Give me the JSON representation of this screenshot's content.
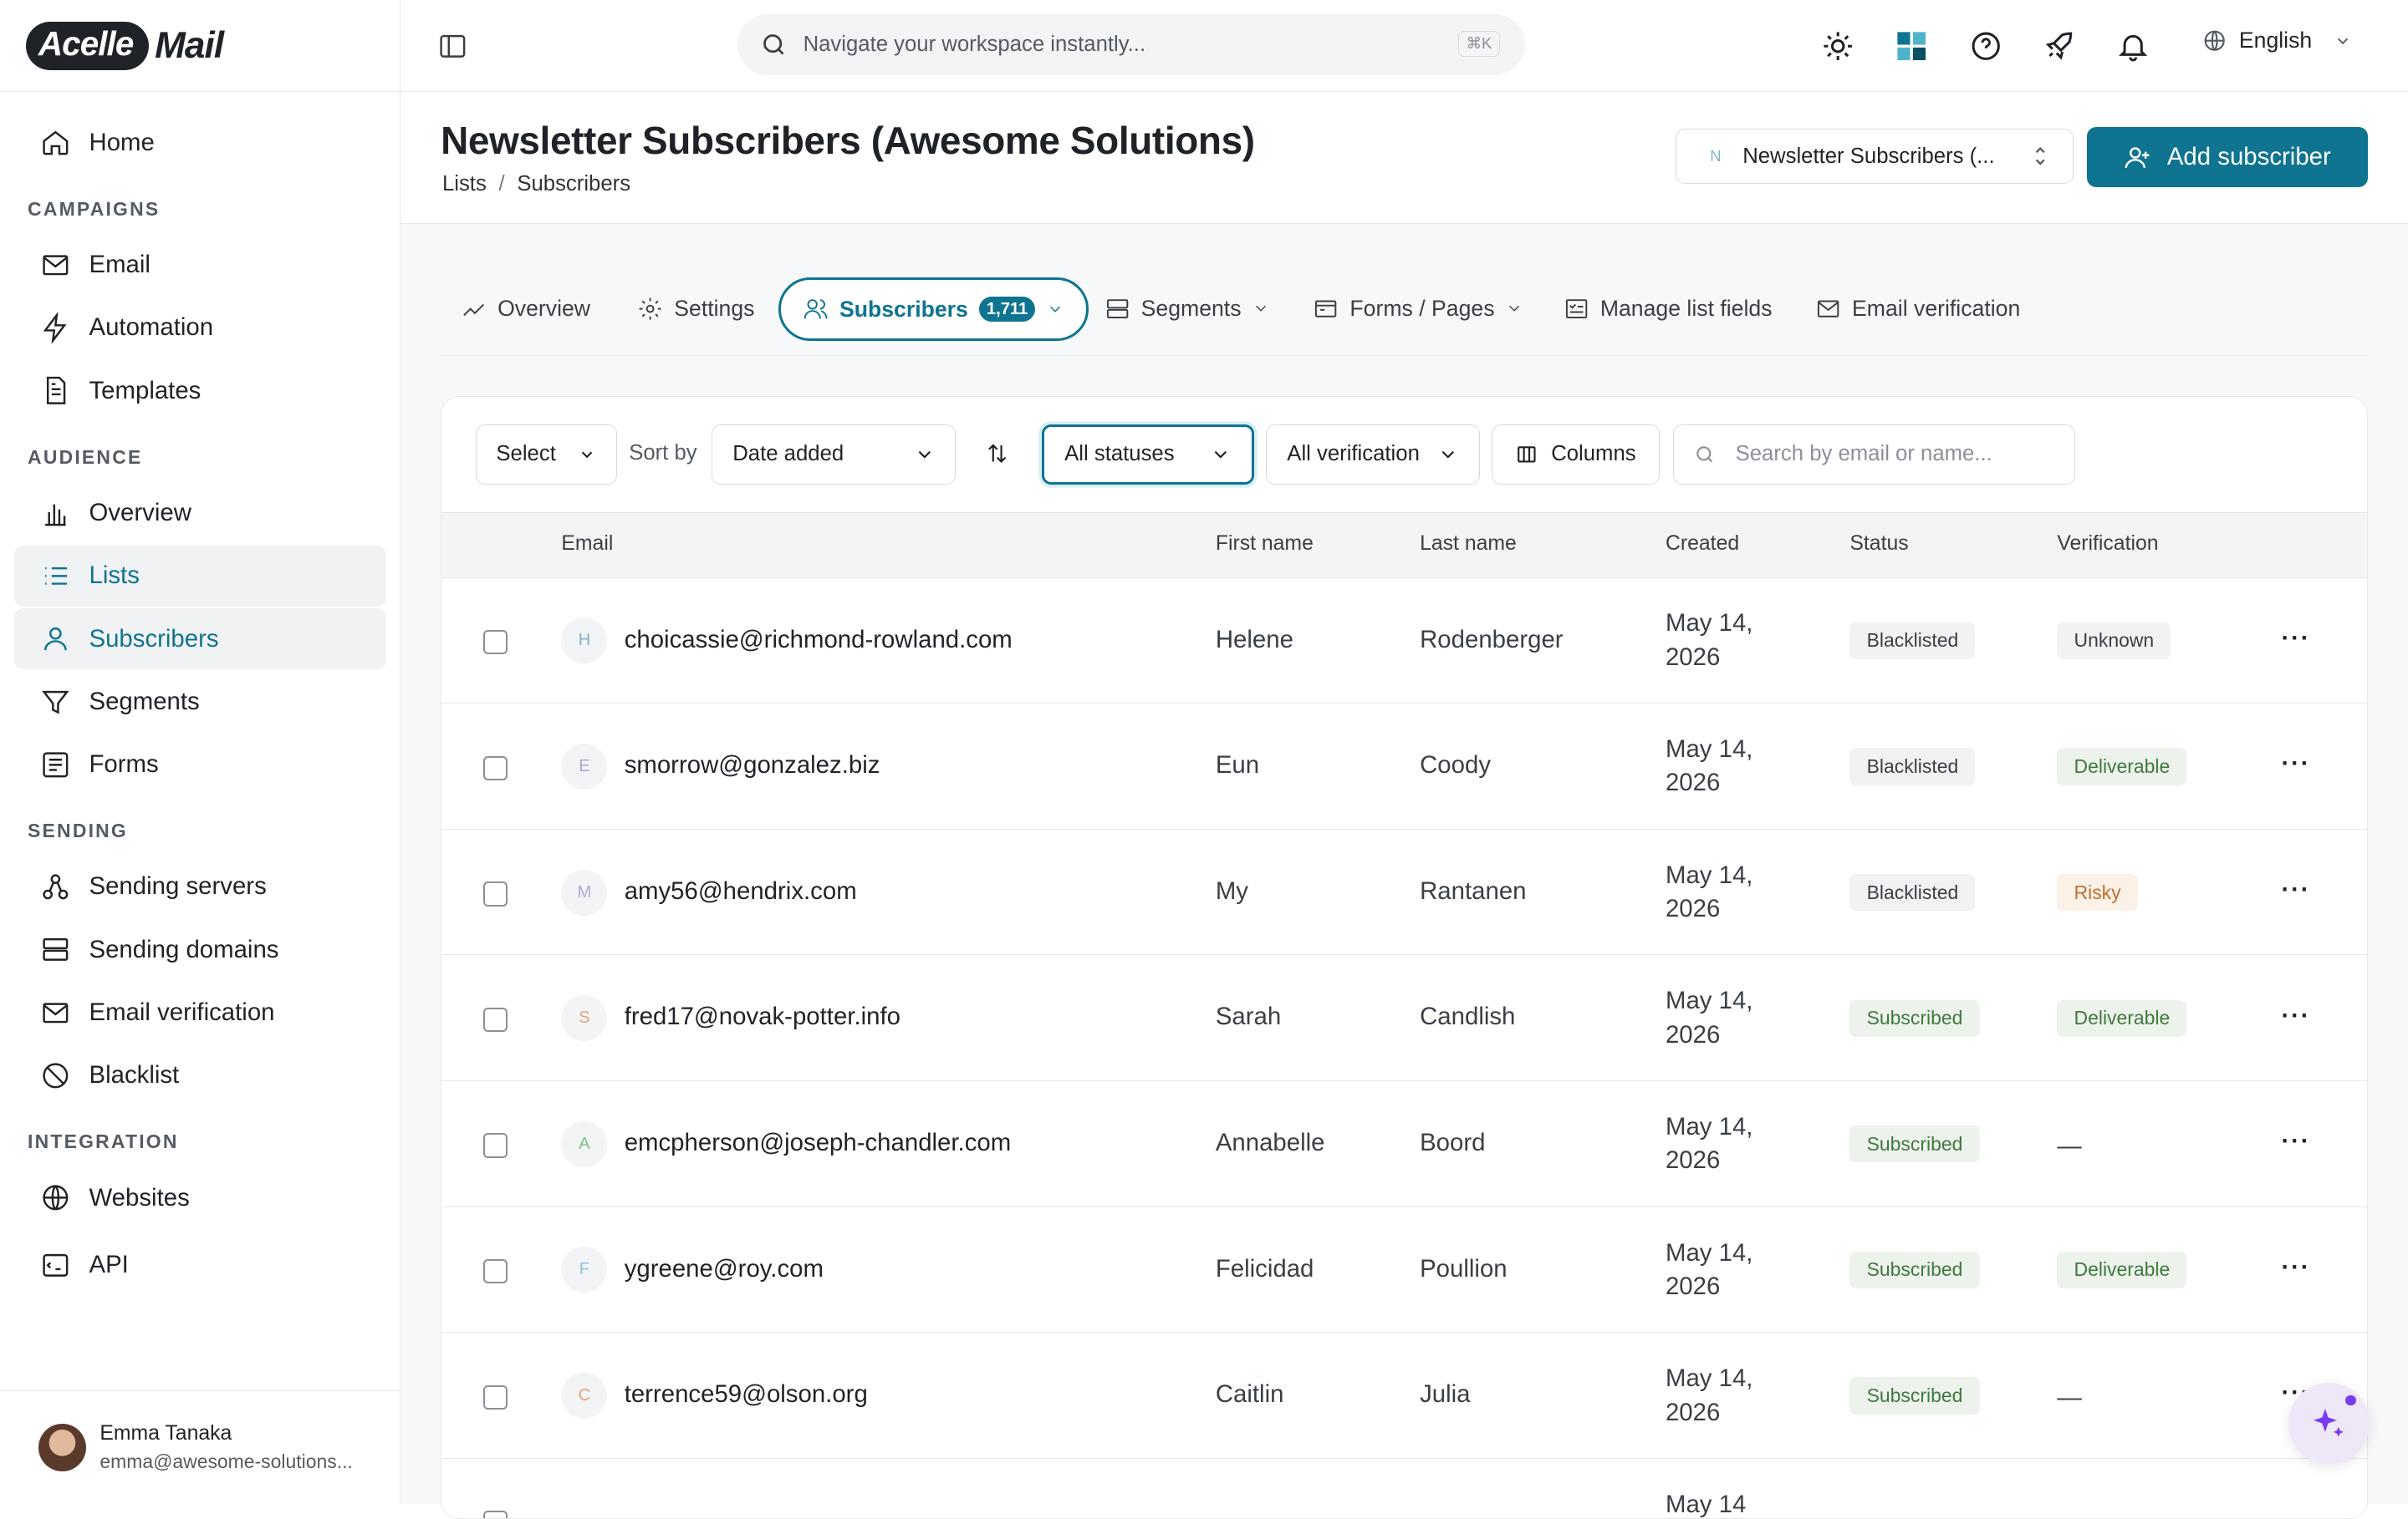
{
  "app": {
    "logo_primary": "Acelle",
    "logo_secondary": "Mail"
  },
  "sidebar": {
    "home": "Home",
    "sections": {
      "campaigns": "CAMPAIGNS",
      "audience": "AUDIENCE",
      "sending": "SENDING",
      "integration": "INTEGRATION"
    },
    "items": {
      "email": "Email",
      "automation": "Automation",
      "templates": "Templates",
      "overview": "Overview",
      "lists": "Lists",
      "subscribers": "Subscribers",
      "segments": "Segments",
      "forms": "Forms",
      "sending_servers": "Sending servers",
      "sending_domains": "Sending domains",
      "email_verification": "Email verification",
      "blacklist": "Blacklist",
      "websites": "Websites",
      "api": "API"
    },
    "user": {
      "name": "Emma Tanaka",
      "email": "emma@awesome-solutions..."
    }
  },
  "topbar": {
    "search_placeholder": "Navigate your workspace instantly...",
    "shortcut": "⌘K",
    "language": "English"
  },
  "header": {
    "title": "Newsletter Subscribers (Awesome Solutions)",
    "breadcrumb": [
      "Lists",
      "Subscribers"
    ],
    "list_selector": {
      "initial": "N",
      "label": "Newsletter Subscribers (..."
    },
    "add_button": "Add subscriber"
  },
  "tabs": {
    "overview": "Overview",
    "settings": "Settings",
    "subscribers": "Subscribers",
    "subscribers_count": "1,711",
    "segments": "Segments",
    "forms": "Forms / Pages",
    "fields": "Manage list fields",
    "verification": "Email verification"
  },
  "toolbar": {
    "select": "Select",
    "sort_by": "Sort by",
    "sort_value": "Date added",
    "status_filter": "All statuses",
    "verification_filter": "All verification",
    "columns": "Columns",
    "search_placeholder": "Search by email or name..."
  },
  "table": {
    "headers": {
      "email": "Email",
      "first": "First name",
      "last": "Last name",
      "created": "Created",
      "status": "Status",
      "verification": "Verification"
    },
    "rows": [
      {
        "initial": "H",
        "initial_color": "#7fb4c7",
        "email": "choicassie@richmond-rowland.com",
        "first": "Helene",
        "last": "Rodenberger",
        "created": "May 14, 2026",
        "status": "Blacklisted",
        "verification": "Unknown"
      },
      {
        "initial": "E",
        "initial_color": "#a9a3d6",
        "email": "smorrow@gonzalez.biz",
        "first": "Eun",
        "last": "Coody",
        "created": "May 14, 2026",
        "status": "Blacklisted",
        "verification": "Deliverable"
      },
      {
        "initial": "M",
        "initial_color": "#b7a6d9",
        "email": "amy56@hendrix.com",
        "first": "My",
        "last": "Rantanen",
        "created": "May 14, 2026",
        "status": "Blacklisted",
        "verification": "Risky"
      },
      {
        "initial": "S",
        "initial_color": "#e5a17a",
        "email": "fred17@novak-potter.info",
        "first": "Sarah",
        "last": "Candlish",
        "created": "May 14, 2026",
        "status": "Subscribed",
        "verification": "Deliverable"
      },
      {
        "initial": "A",
        "initial_color": "#7fbf8a",
        "email": "emcpherson@joseph-chandler.com",
        "first": "Annabelle",
        "last": "Boord",
        "created": "May 14, 2026",
        "status": "Subscribed",
        "verification": "—"
      },
      {
        "initial": "F",
        "initial_color": "#8fc6d9",
        "email": "ygreene@roy.com",
        "first": "Felicidad",
        "last": "Poullion",
        "created": "May 14, 2026",
        "status": "Subscribed",
        "verification": "Deliverable"
      },
      {
        "initial": "C",
        "initial_color": "#e5a17a",
        "email": "terrence59@olson.org",
        "first": "Caitlin",
        "last": "Julia",
        "created": "May 14, 2026",
        "status": "Subscribed",
        "verification": "—"
      },
      {
        "initial": "",
        "initial_color": "#7fb4c7",
        "email": "",
        "first": "",
        "last": "",
        "created": "May 14",
        "status": "",
        "verification": ""
      }
    ]
  },
  "colors": {
    "accent": "#0f7490",
    "subscribed": "#3d7a3c",
    "risky": "#c0702d"
  }
}
